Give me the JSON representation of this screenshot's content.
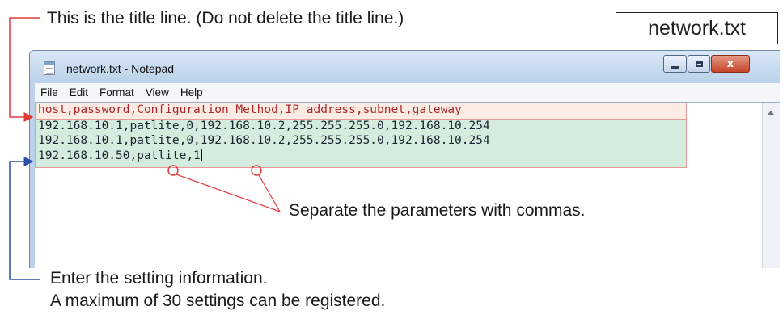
{
  "annotations": {
    "title_note": "This is the title line. (Do not delete the title line.)",
    "file_label": "network.txt",
    "comma_note": "Separate the parameters with commas.",
    "setting_note": "Enter the setting information.",
    "limit_note": "A maximum of 30 settings can be registered."
  },
  "window": {
    "title": "network.txt - Notepad",
    "close_glyph": "x"
  },
  "menu": [
    "File",
    "Edit",
    "Format",
    "View",
    "Help"
  ],
  "editor": {
    "lines": [
      "host,password,Configuration Method,IP address,subnet,gateway",
      "192.168.10.1,patlite,0,192.168.10.2,255.255.255.0,192.168.10.254",
      "192.168.10.1,patlite,0,192.168.10.2,255.255.255.0,192.168.10.254",
      "192.168.10.50,patlite,1"
    ]
  },
  "colors": {
    "title_marker": "#e23b3b",
    "setting_marker": "#2a4fa6",
    "title_highlight": "#fdece4",
    "data_highlight": "#d4ecdd"
  },
  "icons": [
    "notepad-icon",
    "minimize-icon",
    "maximize-icon",
    "close-icon",
    "scroll-up-icon"
  ]
}
